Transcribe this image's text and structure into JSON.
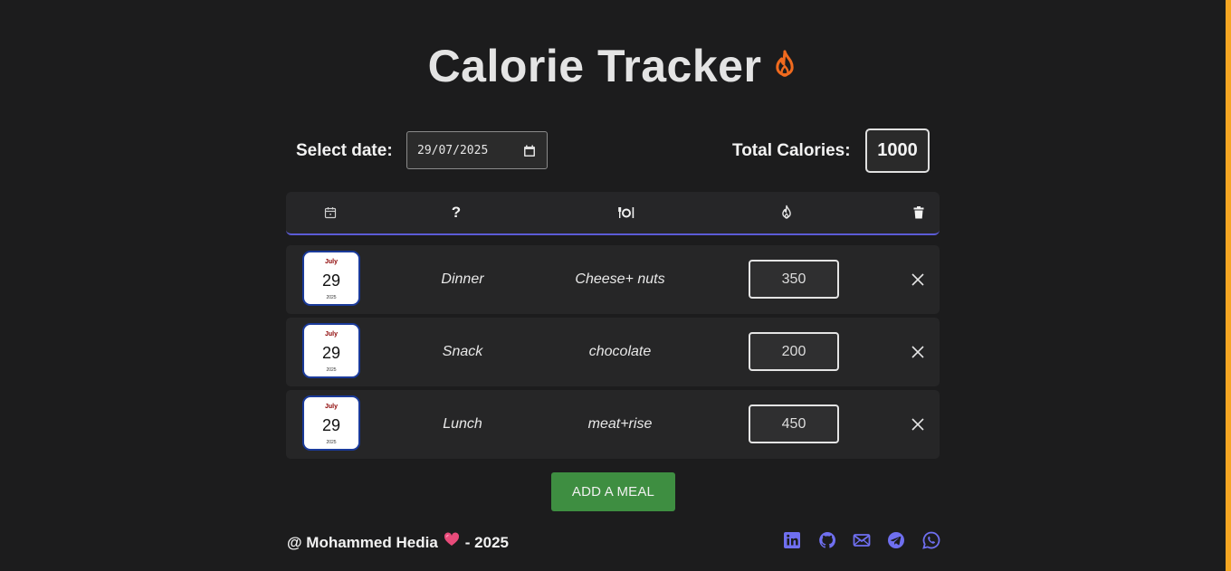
{
  "app": {
    "title": "Calorie Tracker",
    "title_icon": "fire-icon",
    "accent_color": "#f5a623"
  },
  "controls": {
    "date_label": "Select date:",
    "date_value": "29/07/2025",
    "total_label": "Total Calories:",
    "total_value": "1000"
  },
  "table": {
    "header_icons": [
      "calendar-icon",
      "question-icon",
      "plate-utensils-icon",
      "fire-icon",
      "trash-icon"
    ],
    "header_texts": [
      "?"
    ],
    "underline_color": "#5b5bd6",
    "rows": [
      {
        "month": "July",
        "day": "29",
        "year": "2025",
        "meal": "Dinner",
        "food": "Cheese+ nuts",
        "calories": "350"
      },
      {
        "month": "July",
        "day": "29",
        "year": "2025",
        "meal": "Snack",
        "food": "chocolate",
        "calories": "200"
      },
      {
        "month": "July",
        "day": "29",
        "year": "2025",
        "meal": "Lunch",
        "food": "meat+rise",
        "calories": "450"
      }
    ]
  },
  "actions": {
    "add_label": "ADD A MEAL",
    "add_color": "#3e8e41"
  },
  "footer": {
    "author_prefix": "@ Mohammed Hedia",
    "author_suffix": "- 2025",
    "social_icons": [
      "linkedin-icon",
      "github-icon",
      "email-icon",
      "telegram-icon",
      "whatsapp-icon"
    ],
    "social_color": "#6f6ff0"
  }
}
